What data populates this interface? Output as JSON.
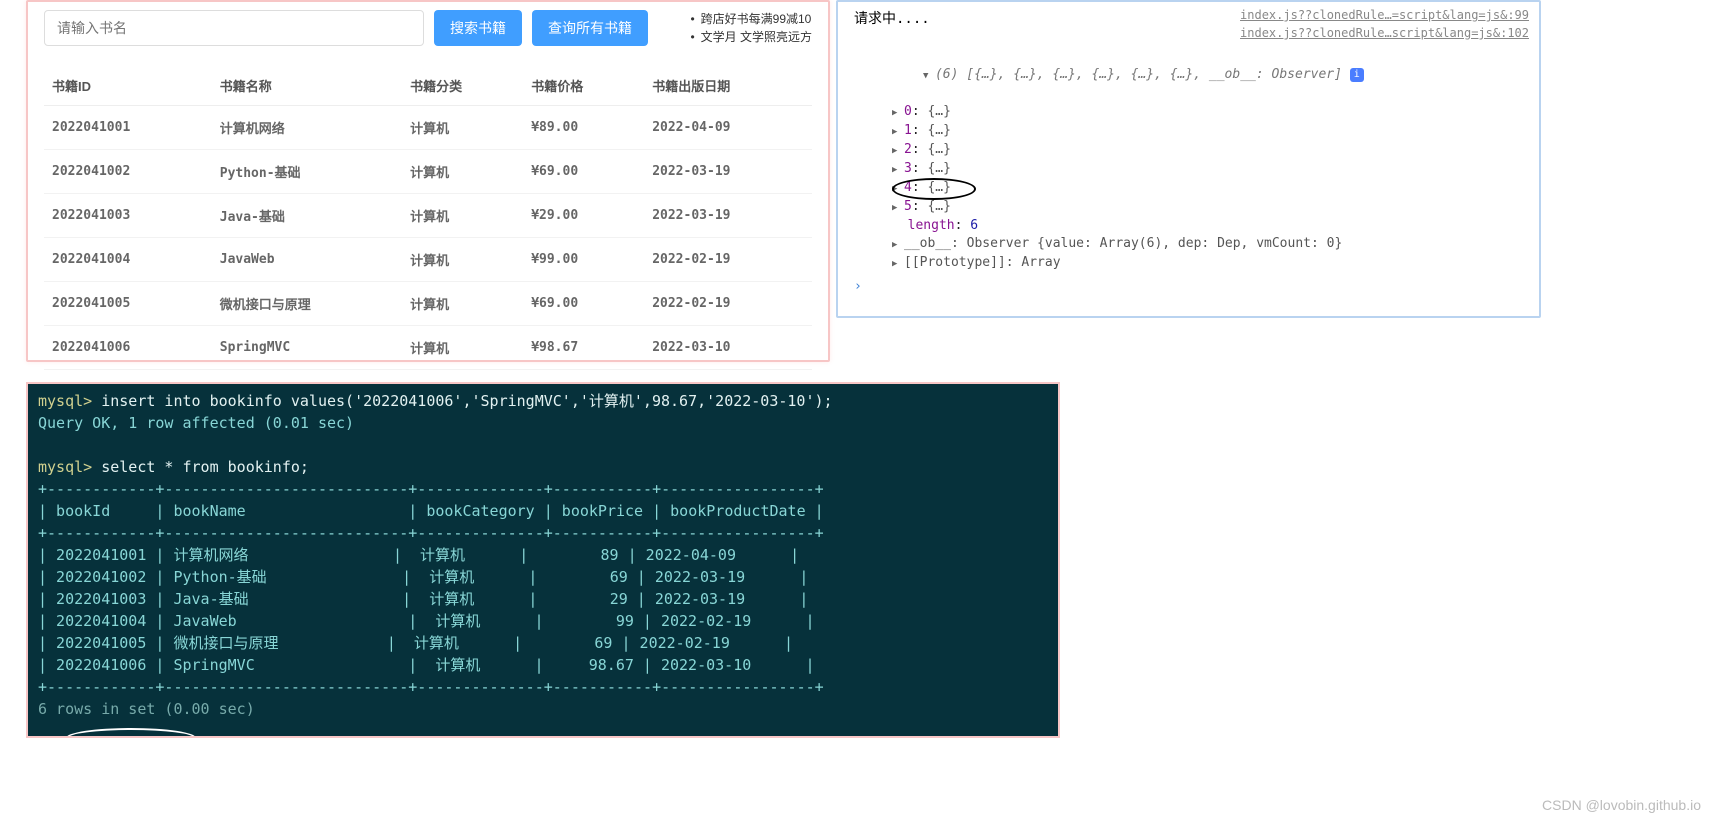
{
  "web": {
    "search_placeholder": "请输入书名",
    "btn_search": "搜索书籍",
    "btn_query_all": "查询所有书籍",
    "promo1": "跨店好书每满99减10",
    "promo2": "文学月 文学照亮远方",
    "headers": {
      "id": "书籍ID",
      "name": "书籍名称",
      "cat": "书籍分类",
      "price": "书籍价格",
      "date": "书籍出版日期"
    },
    "rows": [
      {
        "id": "2022041001",
        "name": "计算机网络",
        "cat": "计算机",
        "price": "¥89.00",
        "date": "2022-04-09"
      },
      {
        "id": "2022041002",
        "name": "Python-基础",
        "cat": "计算机",
        "price": "¥69.00",
        "date": "2022-03-19"
      },
      {
        "id": "2022041003",
        "name": "Java-基础",
        "cat": "计算机",
        "price": "¥29.00",
        "date": "2022-03-19"
      },
      {
        "id": "2022041004",
        "name": "JavaWeb",
        "cat": "计算机",
        "price": "¥99.00",
        "date": "2022-02-19"
      },
      {
        "id": "2022041005",
        "name": "微机接口与原理",
        "cat": "计算机",
        "price": "¥69.00",
        "date": "2022-02-19"
      },
      {
        "id": "2022041006",
        "name": "SpringMVC",
        "cat": "计算机",
        "price": "¥98.67",
        "date": "2022-03-10"
      }
    ]
  },
  "console": {
    "request_text": "请求中....",
    "src1": "index.js??clonedRule…=script&lang=js&:99",
    "src2": "index.js??clonedRule…script&lang=js&:102",
    "array_summary_prefix": "(6) ",
    "array_summary_body": "[{…}, {…}, {…}, {…}, {…}, {…}, __ob__: Observer]",
    "info_badge": "i",
    "items": [
      {
        "k": "0",
        "v": "{…}"
      },
      {
        "k": "1",
        "v": "{…}"
      },
      {
        "k": "2",
        "v": "{…}"
      },
      {
        "k": "3",
        "v": "{…}"
      },
      {
        "k": "4",
        "v": "{…}"
      },
      {
        "k": "5",
        "v": "{…}"
      }
    ],
    "length_key": "length",
    "length_val": "6",
    "ob_line": "__ob__: Observer {value: Array(6), dep: Dep, vmCount: 0}",
    "proto_line": "[[Prototype]]: Array",
    "prompt": "›"
  },
  "terminal": {
    "line1_prompt": "mysql> ",
    "line1_cmd": "insert into bookinfo values('2022041006','SpringMVC','计算机',98.67,'2022-03-10');",
    "line2": "Query OK, 1 row affected (0.01 sec)",
    "blank": "",
    "line3_prompt": "mysql> ",
    "line3_cmd": "select * from bookinfo;",
    "border": "+------------+---------------------------+--------------+-----------+-----------------+",
    "header": "| bookId     | bookName                  | bookCategory | bookPrice | bookProductDate |",
    "rows": [
      "| 2022041001 | 计算机网络                |  计算机      |        89 | 2022-04-09      |",
      "| 2022041002 | Python-基础               |  计算机      |        69 | 2022-03-19      |",
      "| 2022041003 | Java-基础                 |  计算机      |        29 | 2022-03-19      |",
      "| 2022041004 | JavaWeb                   |  计算机      |        99 | 2022-02-19      |",
      "| 2022041005 | 微机接口与原理            |  计算机      |        69 | 2022-02-19      |",
      "| 2022041006 | SpringMVC                 |  计算机      |     98.67 | 2022-03-10      |"
    ],
    "footer": "6 rows in set (0.00 sec)"
  },
  "watermark": "CSDN @lovobin.github.io"
}
